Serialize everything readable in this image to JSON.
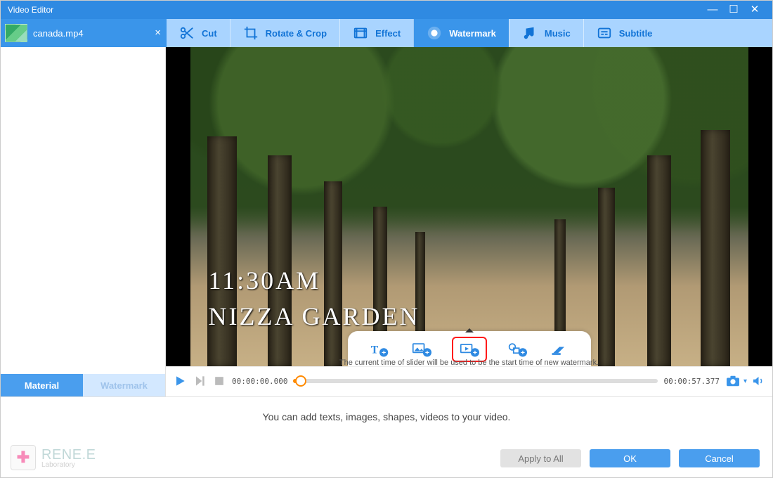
{
  "window": {
    "title": "Video Editor"
  },
  "file": {
    "name": "canada.mp4"
  },
  "tabs": {
    "cut": "Cut",
    "rotate": "Rotate & Crop",
    "effect": "Effect",
    "watermark": "Watermark",
    "music": "Music",
    "subtitle": "Subtitle",
    "active": "watermark"
  },
  "left_tabs": {
    "material": "Material",
    "watermark": "Watermark"
  },
  "preview": {
    "overlay_line1": "11:30AM",
    "overlay_line2": "NIZZA GARDEN"
  },
  "wm_toolbar": {
    "text": "add-text-watermark",
    "image": "add-image-watermark",
    "video": "add-video-watermark",
    "shape": "add-shape-watermark",
    "remove": "remove-watermark"
  },
  "timeline": {
    "current": "00:00:00.000",
    "duration": "00:00:57.377",
    "hint": "The current time of slider will be used to be the start time of new watermark."
  },
  "footer": {
    "message": "You can add texts, images, shapes, videos to your video.",
    "apply_all": "Apply to All",
    "ok": "OK",
    "cancel": "Cancel"
  },
  "brand": {
    "name": "RENE.E",
    "sub": "Laboratory"
  }
}
